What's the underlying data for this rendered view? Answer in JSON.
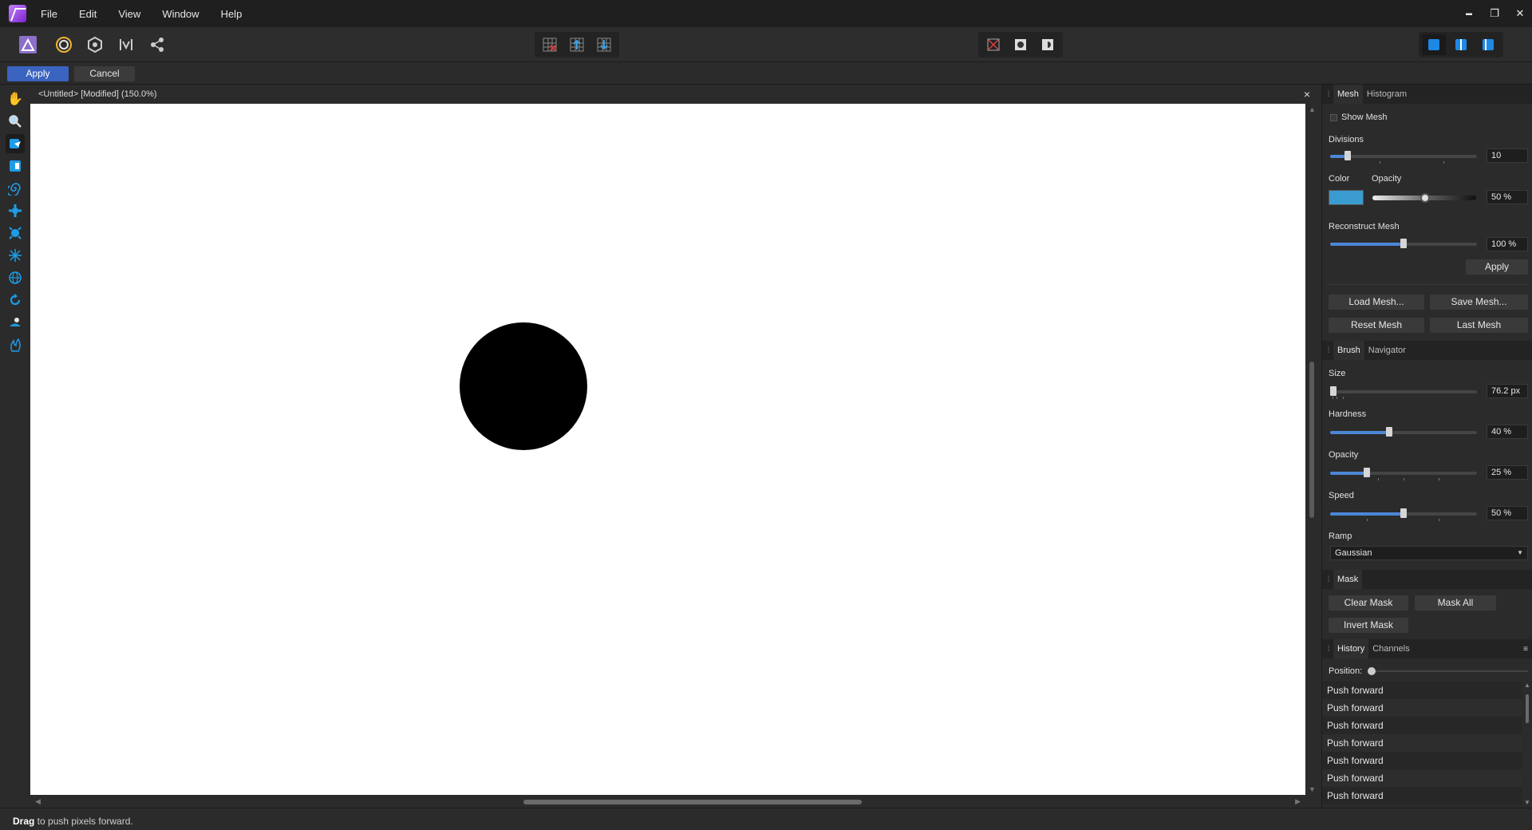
{
  "menubar": {
    "items": [
      "File",
      "Edit",
      "View",
      "Window",
      "Help"
    ],
    "window_controls": {
      "minimize": "▬",
      "restore": "❐",
      "close": "✕"
    }
  },
  "context": {
    "apply_label": "Apply",
    "cancel_label": "Cancel"
  },
  "document": {
    "title": "<Untitled> [Modified] (150.0%)",
    "close_glyph": "×"
  },
  "status": {
    "bold": "Drag",
    "text": " to push pixels forward."
  },
  "panel": {
    "mesh_tabs": [
      "Mesh",
      "Histogram"
    ],
    "show_mesh_label": "Show Mesh",
    "divisions_label": "Divisions",
    "divisions_value": "10",
    "color_label": "Color",
    "opacity_label": "Opacity",
    "opacity_value": "50 %",
    "reconstruct_label": "Reconstruct Mesh",
    "reconstruct_value": "100 %",
    "apply_label": "Apply",
    "load_mesh": "Load Mesh...",
    "save_mesh": "Save Mesh...",
    "reset_mesh": "Reset Mesh",
    "last_mesh": "Last Mesh",
    "brush_tabs": [
      "Brush",
      "Navigator"
    ],
    "size_label": "Size",
    "size_value": "76.2 px",
    "hardness_label": "Hardness",
    "hardness_value": "40 %",
    "brush_opacity_label": "Opacity",
    "brush_opacity_value": "25 %",
    "speed_label": "Speed",
    "speed_value": "50 %",
    "ramp_label": "Ramp",
    "ramp_value": "Gaussian",
    "mask_tab": "Mask",
    "clear_mask": "Clear Mask",
    "mask_all": "Mask All",
    "invert_mask": "Invert Mask",
    "history_tabs": [
      "History",
      "Channels"
    ],
    "position_label": "Position:",
    "history_items": [
      "Push forward",
      "Push forward",
      "Push forward",
      "Push forward",
      "Push forward",
      "Push forward",
      "Push forward"
    ]
  },
  "levels": {
    "divisions": 0.12,
    "mesh_opacity": 0.5,
    "reconstruct": 0.5,
    "size": 0.02,
    "hardness": 0.4,
    "brush_opacity": 0.25,
    "speed": 0.5,
    "history_position": 0.0
  },
  "colors": {
    "accent": "#3a64c0",
    "slider_fill": "#4c86d6",
    "mesh_color": "#3a9bd0"
  }
}
